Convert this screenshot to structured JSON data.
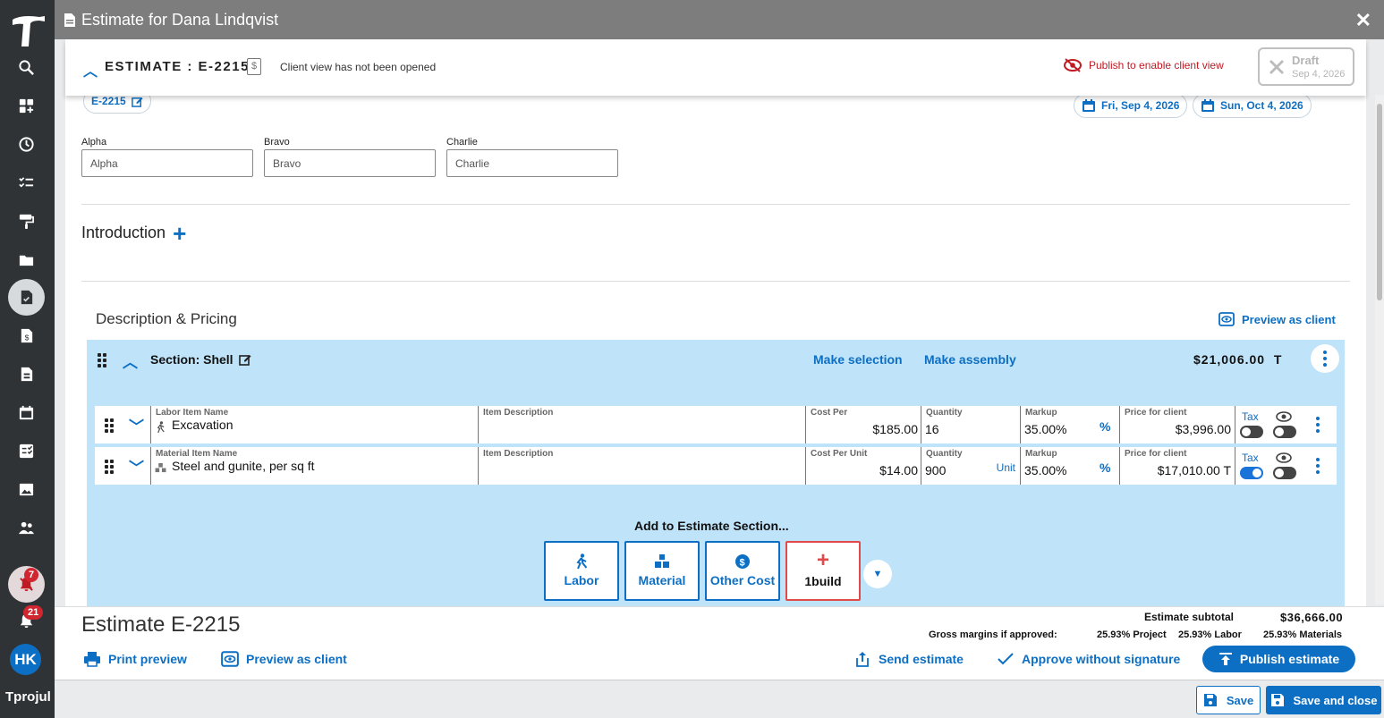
{
  "modal": {
    "title": "Estimate for Dana Lindqvist",
    "close": "✕"
  },
  "sidebar": {
    "badge_notifications_red": "7",
    "badge_bell": "21",
    "avatar_initials": "HK",
    "brand": "projul"
  },
  "header": {
    "estimate_label": "ESTIMATE : E-2215",
    "view_note": "Client view has not been opened",
    "publish_enable": "Publish to enable client view",
    "draft_title": "Draft",
    "draft_date": "Sep 4, 2026"
  },
  "chips": {
    "number": "E-2215",
    "start_date": "Fri, Sep 4, 2026",
    "end_date": "Sun, Oct 4, 2026"
  },
  "fields": [
    {
      "label": "Alpha",
      "value": "Alpha"
    },
    {
      "label": "Bravo",
      "value": "Bravo"
    },
    {
      "label": "Charlie",
      "value": "Charlie"
    }
  ],
  "introduction": {
    "label": "Introduction"
  },
  "description": {
    "title": "Description & Pricing",
    "preview_label": "Preview as client"
  },
  "section": {
    "title": "Section: Shell",
    "make_selection": "Make selection",
    "make_assembly": "Make assembly",
    "total": "$21,006.00",
    "total_tax_flag": "T",
    "add_title": "Add to Estimate Section...",
    "add_buttons": {
      "labor": "Labor",
      "material": "Material",
      "other_cost": "Other Cost",
      "onebuild": "1build"
    }
  },
  "rows": [
    {
      "name_label": "Labor Item Name",
      "name": "Excavation",
      "desc_label": "Item Description",
      "desc": "",
      "cost_label": "Cost Per",
      "cost": "$185.00",
      "qty_label": "Quantity",
      "qty": "16",
      "unit": "",
      "markup_label": "Markup",
      "markup": "35.00%",
      "markup_unit": "%",
      "price_label": "Price for client",
      "price": "$3,996.00",
      "tax_label": "Tax"
    },
    {
      "name_label": "Material Item Name",
      "name": "Steel and gunite, per sq ft",
      "desc_label": "Item Description",
      "desc": "",
      "cost_label": "Cost Per Unit",
      "cost": "$14.00",
      "qty_label": "Quantity",
      "qty": "900",
      "unit": "Unit",
      "markup_label": "Markup",
      "markup": "35.00%",
      "markup_unit": "%",
      "price_label": "Price for client",
      "price": "$17,010.00 T",
      "tax_label": "Tax"
    }
  ],
  "footer": {
    "title": "Estimate E-2215",
    "subtotal_label": "Estimate subtotal",
    "subtotal_value": "$36,666.00",
    "gm_label": "Gross margins if approved:",
    "gm_project": "25.93% Project",
    "gm_labor": "25.93% Labor",
    "gm_materials": "25.93% Materials",
    "print_preview": "Print preview",
    "preview_client": "Preview as client",
    "send_estimate": "Send estimate",
    "approve": "Approve without signature",
    "publish": "Publish estimate"
  },
  "bottom": {
    "save": "Save",
    "save_close": "Save and close"
  },
  "colors": {
    "accent": "#0d6fc4",
    "section_bg": "#bfe3f9",
    "danger": "#c01b24"
  }
}
